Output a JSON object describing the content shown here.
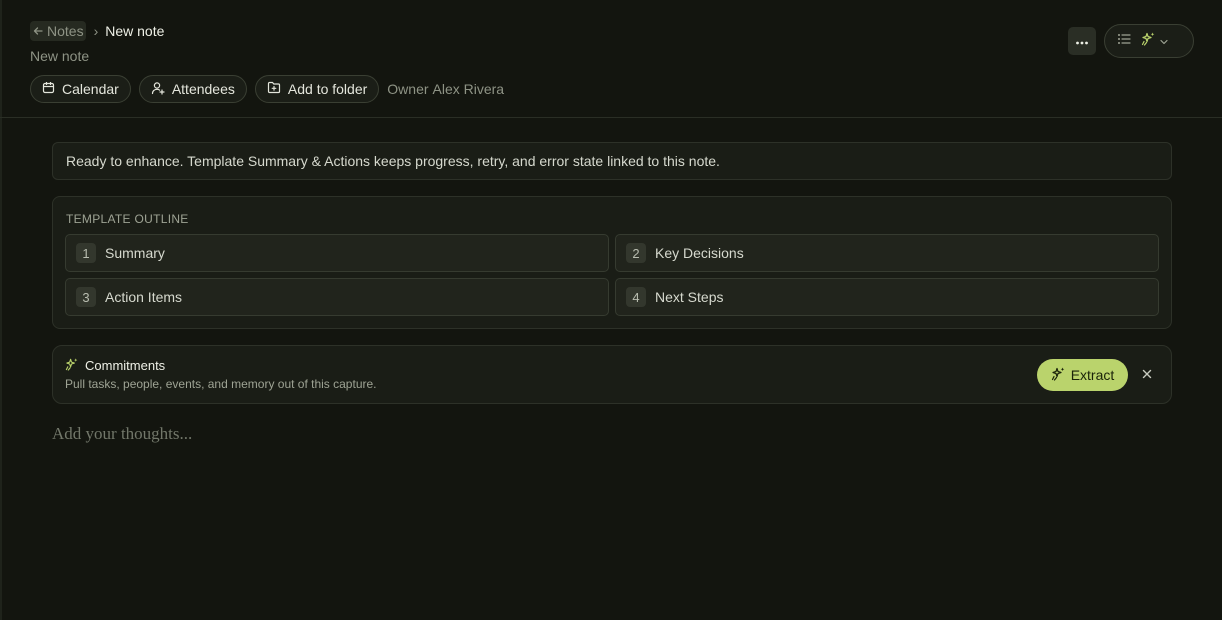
{
  "breadcrumb": {
    "back_label": "Notes",
    "separator": "›",
    "current": "New note"
  },
  "note": {
    "title": "New note"
  },
  "chips": {
    "calendar": "Calendar",
    "attendees": "Attendees",
    "add_folder": "Add to folder",
    "owner_label": "Owner",
    "owner_name": "Alex Rivera"
  },
  "toolbar": {
    "more_icon": "ellipsis-icon",
    "list_icon": "list-icon",
    "enhance_icon": "sparkles-icon",
    "chevron_icon": "chevron-down-icon"
  },
  "banner": {
    "text": "Ready to enhance. Template Summary & Actions keeps progress, retry, and error state linked to this note."
  },
  "outline": {
    "heading": "TEMPLATE OUTLINE",
    "items": [
      {
        "num": "1",
        "label": "Summary"
      },
      {
        "num": "2",
        "label": "Key Decisions"
      },
      {
        "num": "3",
        "label": "Action Items"
      },
      {
        "num": "4",
        "label": "Next Steps"
      }
    ]
  },
  "commitments": {
    "title": "Commitments",
    "subtitle": "Pull tasks, people, events, and memory out of this capture.",
    "extract_label": "Extract",
    "dismiss_icon": "close-icon"
  },
  "editor": {
    "placeholder": "Add your thoughts..."
  },
  "colors": {
    "background": "#13150f",
    "accent": "#bad36c",
    "panel": "#1a1d16"
  }
}
